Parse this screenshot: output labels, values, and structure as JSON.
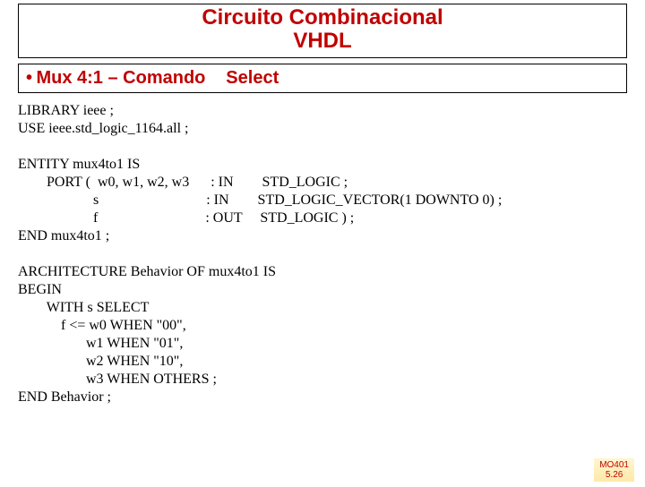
{
  "title_line1": "Circuito Combinacional",
  "title_line2": "VHDL",
  "subtitle_bullet": "•",
  "subtitle_main": "Mux 4:1 – Comando",
  "subtitle_extra": "Select",
  "code": "LIBRARY ieee ;\nUSE ieee.std_logic_1164.all ;\n\nENTITY mux4to1 IS\n        PORT (  w0, w1, w2, w3      : IN        STD_LOGIC ;\n                     s                              : IN        STD_LOGIC_VECTOR(1 DOWNTO 0) ;\n                     f                              : OUT     STD_LOGIC ) ;\nEND mux4to1 ;\n\nARCHITECTURE Behavior OF mux4to1 IS\nBEGIN\n        WITH s SELECT\n            f <= w0 WHEN \"00\",\n                   w1 WHEN \"01\",\n                   w2 WHEN \"10\",\n                   w3 WHEN OTHERS ;\nEND Behavior ;",
  "footer_line1": "MO401",
  "footer_line2": "5.26"
}
